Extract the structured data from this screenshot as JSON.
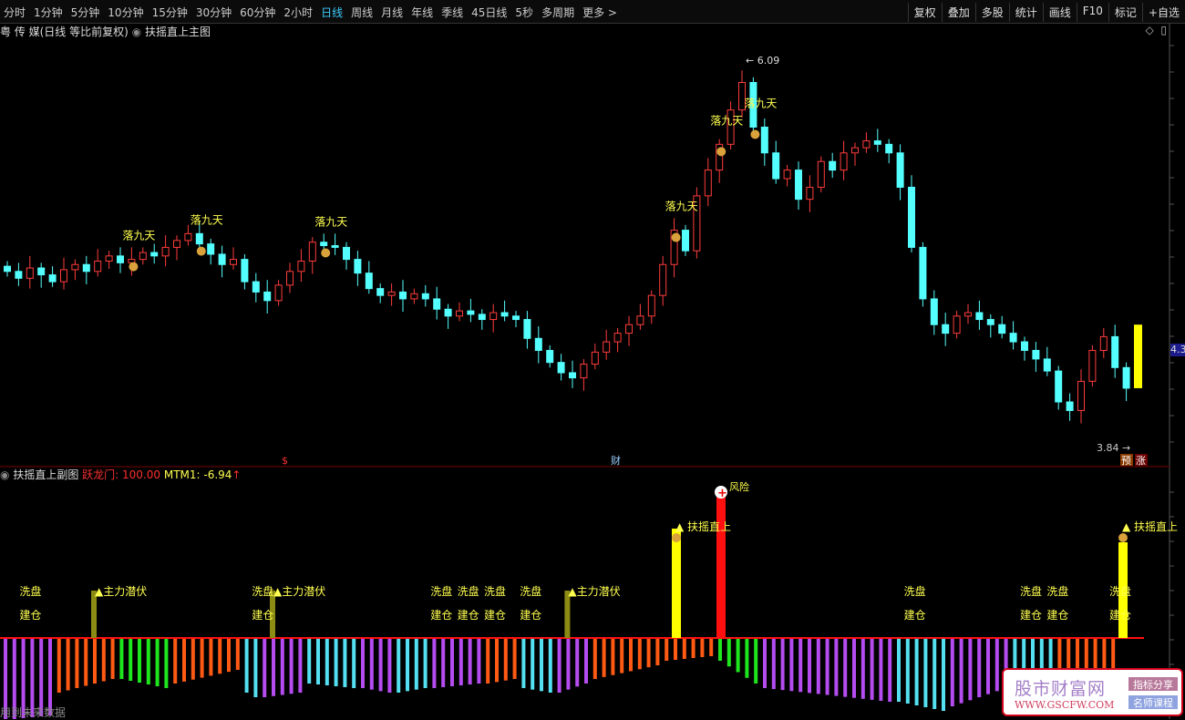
{
  "toolbar": {
    "periods": [
      "分时",
      "1分钟",
      "5分钟",
      "10分钟",
      "15分钟",
      "30分钟",
      "60分钟",
      "2小时",
      "日线",
      "周线",
      "月线",
      "年线",
      "季线",
      "45日线",
      "5秒",
      "多周期",
      "更多 >"
    ],
    "active": "日线",
    "right": [
      "复权",
      "叠加",
      "多股",
      "统计",
      "画线",
      "F10",
      "标记",
      "+自选"
    ]
  },
  "main": {
    "title": "粤 传 媒(日线 等比前复权)",
    "indicator": "扶摇直上主图",
    "high_label": "6.09",
    "low_label": "3.84",
    "price_tag": "4.3",
    "badges": [
      "预",
      "涨"
    ],
    "signal_label": "落九天",
    "markers": [
      "$",
      "财"
    ]
  },
  "sub": {
    "indicator": "扶摇直上副图",
    "line1_label": "跃龙门: 100.00",
    "line2_label": "MTM1: -6.94",
    "line2_arrow": "↑",
    "labels": {
      "wash": "洗盘",
      "build": "建仓",
      "lurk": "主力潜伏",
      "rise": "扶摇直上",
      "risk": "风险"
    }
  },
  "footer": {
    "text": "用到未来数据"
  },
  "watermark": {
    "name": "股市财富网",
    "url": "WWW.GSCFW.COM",
    "btn1": "指标分享",
    "btn2": "名师课程"
  },
  "colors": {
    "up": "#ff3c3c",
    "down": "#54ffff",
    "purple": "#b44cf0",
    "orange": "#ff5a14",
    "green": "#1ee61e",
    "cyan": "#54e0f0",
    "yellow": "#ffff00",
    "olive": "#8c8c14",
    "red": "#ff1010"
  },
  "chart_data": {
    "type": "candlestick",
    "price_range": [
      3.84,
      6.09
    ],
    "closes": [
      4.86,
      4.82,
      4.88,
      4.84,
      4.8,
      4.87,
      4.9,
      4.86,
      4.92,
      4.95,
      4.91,
      4.93,
      4.97,
      4.95,
      5.0,
      5.04,
      5.08,
      5.02,
      4.96,
      4.9,
      4.93,
      4.8,
      4.74,
      4.69,
      4.78,
      4.86,
      4.92,
      5.03,
      5.01,
      5.0,
      4.93,
      4.85,
      4.76,
      4.72,
      4.74,
      4.7,
      4.73,
      4.7,
      4.64,
      4.6,
      4.63,
      4.61,
      4.58,
      4.62,
      4.6,
      4.58,
      4.47,
      4.4,
      4.33,
      4.27,
      4.24,
      4.32,
      4.39,
      4.45,
      4.5,
      4.55,
      4.6,
      4.72,
      4.9,
      5.1,
      4.98,
      5.3,
      5.45,
      5.6,
      5.8,
      5.96,
      5.7,
      5.55,
      5.4,
      5.45,
      5.28,
      5.35,
      5.5,
      5.45,
      5.55,
      5.58,
      5.62,
      5.6,
      5.55,
      5.35,
      5.0,
      4.7,
      4.55,
      4.5,
      4.6,
      4.62,
      4.58,
      4.55,
      4.5,
      4.45,
      4.4,
      4.35,
      4.28,
      4.1,
      4.05,
      4.22,
      4.4,
      4.48,
      4.3,
      4.18
    ],
    "forecast": {
      "open": 4.18,
      "close": 4.55
    },
    "signals_fall": [
      11,
      17,
      28,
      59,
      63,
      66
    ],
    "sub_segments": [
      {
        "c": "purple",
        "n": 6,
        "a": -90,
        "b": -85
      },
      {
        "c": "orange",
        "n": 7,
        "a": -60,
        "b": -45
      },
      {
        "c": "green",
        "n": 6,
        "a": -45,
        "b": -55
      },
      {
        "c": "orange",
        "n": 8,
        "a": -50,
        "b": -35
      },
      {
        "c": "cyan",
        "n": 2,
        "a": -60,
        "b": -65
      },
      {
        "c": "purple",
        "n": 5,
        "a": -65,
        "b": -60
      },
      {
        "c": "cyan",
        "n": 6,
        "a": -50,
        "b": -55
      },
      {
        "c": "purple",
        "n": 4,
        "a": -55,
        "b": -60
      },
      {
        "c": "cyan",
        "n": 4,
        "a": -60,
        "b": -55
      },
      {
        "c": "purple",
        "n": 6,
        "a": -55,
        "b": -50
      },
      {
        "c": "orange",
        "n": 4,
        "a": -50,
        "b": -45
      },
      {
        "c": "cyan",
        "n": 4,
        "a": -55,
        "b": -60
      },
      {
        "c": "purple",
        "n": 4,
        "a": -60,
        "b": -50
      },
      {
        "c": "orange",
        "n": 8,
        "a": -45,
        "b": -30
      },
      {
        "c": "orange",
        "n": 6,
        "a": -25,
        "b": -20
      },
      {
        "c": "green",
        "n": 5,
        "a": -25,
        "b": -50
      },
      {
        "c": "purple",
        "n": 15,
        "a": -55,
        "b": -70
      },
      {
        "c": "cyan",
        "n": 6,
        "a": -70,
        "b": -80
      },
      {
        "c": "purple",
        "n": 7,
        "a": -75,
        "b": -55
      },
      {
        "c": "cyan",
        "n": 5,
        "a": -60,
        "b": -70
      },
      {
        "c": "orange",
        "n": 7,
        "a": -50,
        "b": -35
      }
    ],
    "tall_bars": [
      {
        "i": 10,
        "v": 52,
        "c": "olive"
      },
      {
        "i": 30,
        "v": 52,
        "c": "olive"
      },
      {
        "i": 63,
        "v": 52,
        "c": "olive"
      },
      {
        "i": 75,
        "v": 120,
        "c": "yellow"
      },
      {
        "i": 80,
        "v": 160,
        "c": "red"
      },
      {
        "i": 125,
        "v": 105,
        "c": "yellow"
      }
    ],
    "wash_at": [
      3,
      29,
      49,
      52,
      55,
      59,
      102,
      115,
      118,
      125
    ],
    "lurk_at": [
      10,
      30,
      63
    ],
    "rise_at": [
      75,
      125
    ]
  }
}
